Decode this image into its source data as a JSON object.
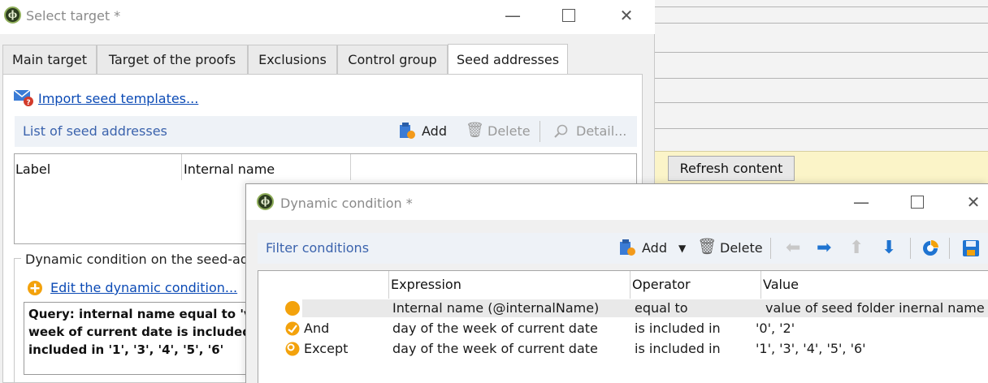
{
  "background_window": {
    "refresh_button": "Refresh content"
  },
  "select_target": {
    "title": "Select target *",
    "tabs": [
      {
        "label": "Main target"
      },
      {
        "label": "Target of the proofs"
      },
      {
        "label": "Exclusions"
      },
      {
        "label": "Control group"
      },
      {
        "label": "Seed addresses",
        "active": true
      }
    ],
    "import_link": "Import seed templates...",
    "seed_list": {
      "title": "List of seed addresses",
      "add": "Add",
      "delete": "Delete",
      "detail": "Detail...",
      "columns": [
        "Label",
        "Internal name"
      ]
    },
    "dynamic_group": {
      "label": "Dynamic condition on the seed-ad",
      "edit_link": "Edit the dynamic condition...",
      "query_lines": [
        "Query: internal name equal to 'v",
        "week of current date is included",
        "included in '1', '3', '4', '5', '6'"
      ]
    }
  },
  "dynamic_condition": {
    "title": "Dynamic condition *",
    "filter_title": "Filter conditions",
    "add": "Add",
    "delete": "Delete",
    "columns": [
      "Expression",
      "Operator",
      "Value"
    ],
    "rows": [
      {
        "logic": "",
        "expression": "Internal name (@internalName)",
        "operator": "equal to",
        "value": "value of seed folder inernal name"
      },
      {
        "logic": "And",
        "expression": "day of the week of current date",
        "operator": "is included in",
        "value": "'0', '2'"
      },
      {
        "logic": "Except",
        "expression": "day of the week of current date",
        "operator": "is included in",
        "value": "'1', '3', '4', '5', '6'"
      }
    ]
  },
  "colors": {
    "link": "#0b4ab5",
    "section_title": "#3b63ad",
    "arrow_blue": "#1f74d1",
    "condition_orange": "#f3a20c",
    "refresh_band": "#fbf4c8"
  }
}
